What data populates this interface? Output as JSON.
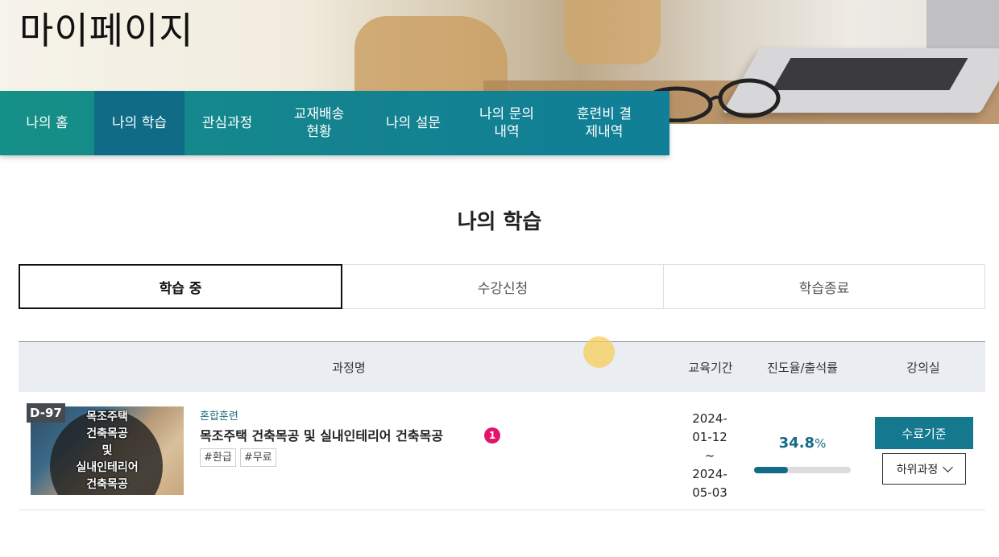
{
  "hero": {
    "title": "마이페이지"
  },
  "nav": {
    "items": [
      {
        "label": "나의 홈",
        "active": false
      },
      {
        "label": "나의 학습",
        "active": true
      },
      {
        "label": "관심과정",
        "active": false
      },
      {
        "label": "교재배송\n현황",
        "active": false
      },
      {
        "label": "나의 설문",
        "active": false
      },
      {
        "label": "나의 문의\n내역",
        "active": false
      },
      {
        "label": "훈련비 결\n제내역",
        "active": false
      }
    ]
  },
  "section": {
    "title": "나의 학습"
  },
  "tabs": [
    {
      "label": "학습 중",
      "active": true
    },
    {
      "label": "수강신청",
      "active": false
    },
    {
      "label": "학습종료",
      "active": false
    }
  ],
  "table": {
    "headers": {
      "course": "과정명",
      "period": "교육기간",
      "progress": "진도율/출석률",
      "classroom": "강의실"
    },
    "rows": [
      {
        "dday": "D-97",
        "thumb_lines": [
          "목조주택",
          "건축목공",
          "및",
          "실내인테리어",
          "건축목공"
        ],
        "type": "혼합훈련",
        "title": "목조주택 건축목공 및 실내인테리어 건축목공",
        "badge": "1",
        "tags": [
          "#환급",
          "#무료"
        ],
        "period_lines": [
          "2024-",
          "01-12",
          "~",
          "2024-",
          "05-03"
        ],
        "progress": "34.8",
        "progress_unit": "%",
        "progress_fraction": 0.348,
        "primary_button": "수료기준",
        "select_button": "하위과정"
      }
    ]
  },
  "colors": {
    "nav": "#14838f",
    "nav_active": "#0f6b86",
    "accent": "#14788f",
    "badge": "#e2156b"
  }
}
